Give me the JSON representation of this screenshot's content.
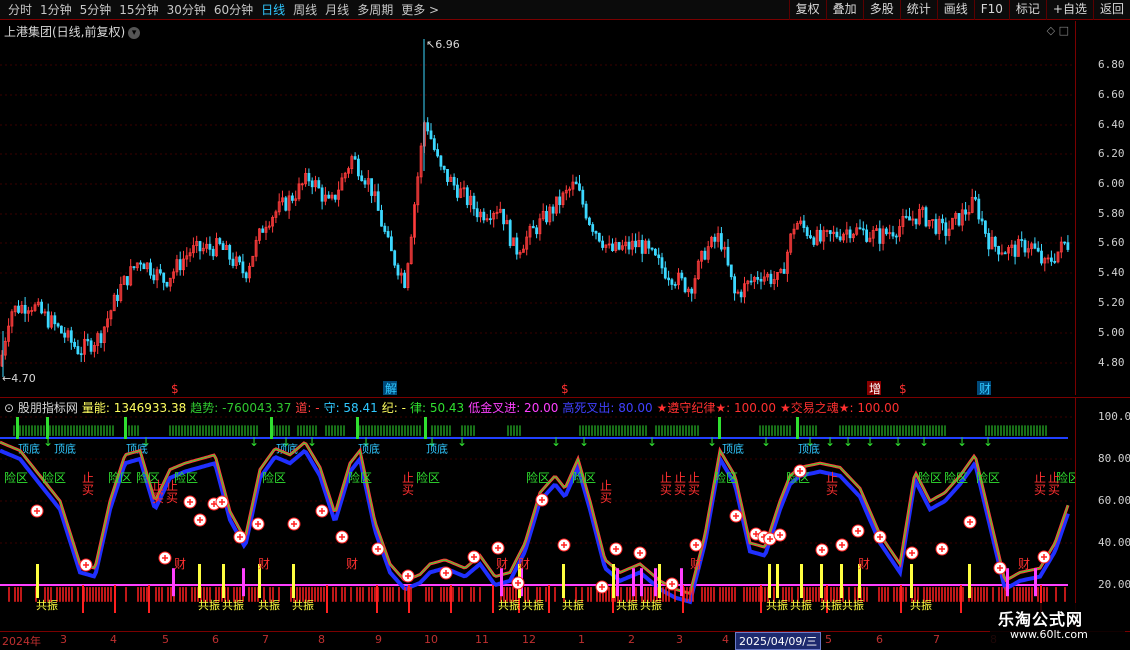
{
  "toolbar": {
    "periods": [
      "分时",
      "1分钟",
      "5分钟",
      "15分钟",
      "30分钟",
      "60分钟",
      "日线",
      "周线",
      "月线",
      "多周期",
      "更多 >"
    ],
    "active_period": "日线",
    "actions": [
      "复权",
      "叠加",
      "多股",
      "统计",
      "画线",
      "F10",
      "标记",
      "+自选",
      "返回"
    ]
  },
  "main_chart": {
    "title": "上港集团(日线,前复权)",
    "high_label": "6.96",
    "low_label": "4.70",
    "price_axis": [
      "6.80",
      "6.60",
      "6.40",
      "6.20",
      "6.00",
      "5.80",
      "5.60",
      "5.40",
      "5.20",
      "5.00",
      "4.80"
    ],
    "markers": [
      {
        "text": "$",
        "color": "#ff3030"
      },
      {
        "text": "解",
        "color": "#30c8ff"
      },
      {
        "text": "$",
        "color": "#ff3030"
      },
      {
        "text": "增",
        "color": "#ffffff"
      },
      {
        "text": "$",
        "color": "#ff3030"
      },
      {
        "text": "财",
        "color": "#30c8ff"
      }
    ]
  },
  "indicator": {
    "name": "股朋指标网",
    "items": [
      {
        "label": "量能: 1346933.38",
        "color": "#ffff60"
      },
      {
        "label": "趋势: -760043.37",
        "color": "#30c830"
      },
      {
        "label": "道: -",
        "color": "#ff4040"
      },
      {
        "label": "守: 58.41",
        "color": "#30c8ff"
      },
      {
        "label": "纪: -",
        "color": "#ffff60"
      },
      {
        "label": "律: 50.43",
        "color": "#30e030"
      },
      {
        "label": "低金叉进: 20.00",
        "color": "#ff40ff"
      },
      {
        "label": "高死叉出: 80.00",
        "color": "#4040ff"
      },
      {
        "label": "★遵守纪律★: 100.00",
        "color": "#ff3030"
      },
      {
        "label": "★交易之魂★: 100.00",
        "color": "#ff3030"
      }
    ],
    "axis": [
      "100.0",
      "80.00",
      "60.00",
      "40.00",
      "20.00"
    ],
    "labels": {
      "risk": "险区",
      "stop": "止",
      "buy": "买",
      "wealth": "财",
      "resonance": "共振",
      "bottom": "顶底"
    }
  },
  "date_axis": {
    "labels": [
      "2024年",
      "3",
      "4",
      "5",
      "6",
      "7",
      "8",
      "9",
      "10",
      "11",
      "12",
      "1",
      "2",
      "3",
      "4",
      "5",
      "6",
      "7",
      "8"
    ],
    "cursor_date": "2025/04/09/三"
  },
  "watermark": {
    "name": "乐淘公式网",
    "url": "www.60lt.com"
  }
}
